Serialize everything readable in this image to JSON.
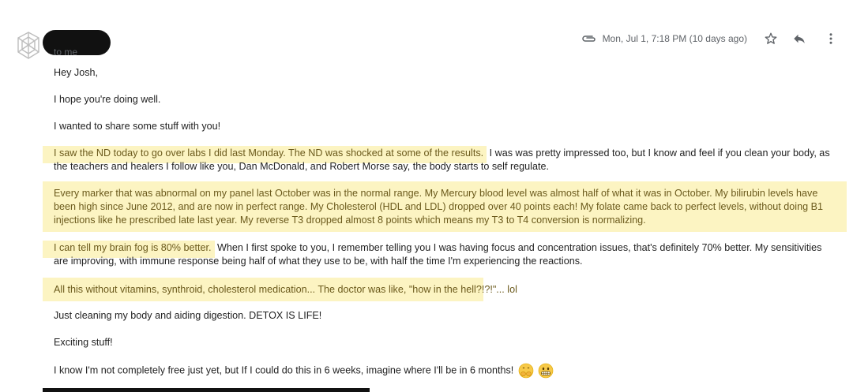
{
  "header": {
    "date": "Mon, Jul 1, 7:18 PM (10 days ago)",
    "to_line": "to me"
  },
  "icons": {
    "avatar": "default-avatar-icon",
    "attachment": "paperclip-icon",
    "star": "star-icon",
    "reply": "reply-icon",
    "more": "more-vert-icon"
  },
  "body": {
    "greeting": "Hey Josh,",
    "line1": "I hope you're doing well.",
    "line2": "I wanted to share some stuff with you!",
    "p3_highlight": "I saw the ND today to go over labs I did last Monday. The ND was shocked at some of the results.",
    "p3_rest": " I was was pretty impressed too, but I know and feel if you clean your body, as the teachers and healers I follow like you, Dan McDonald, and Robert Morse say, the body starts to self regulate.",
    "p4": "Every marker that was abnormal on my panel last October was in the normal range. My Mercury blood level was almost half of what it was in October. My bilirubin levels have been high since June 2012, and are now in perfect range. My Cholesterol (HDL and LDL) dropped over 40 points each! My folate came back to perfect levels, without doing B1 injections like he prescribed late last year. My reverse T3 dropped almost 8 points which means my T3 to T4 conversion is normalizing.",
    "p5_highlight": "I can tell my brain fog is 80% better.",
    "p5_rest": " When I first spoke to you, I remember telling you I was having focus and concentration issues, that's definitely 70% better. My sensitivities are improving, with immune response being half of what they use to be, with half the time I'm experiencing the reactions.",
    "p6": "All this without vitamins, synthroid, cholesterol medication... The doctor was like, \"how in the hell?!?!\"... lol",
    "p7": "Just cleaning my body and aiding digestion. DETOX IS LIFE!",
    "p8": "Exciting stuff!",
    "p9": "I know I'm not completely free just yet, but If I could do this in 6 weeks, imagine where I'll be in 6 months!",
    "emojis": [
      "hands-over-mouth-emoji",
      "grimacing-face-emoji"
    ]
  },
  "colors": {
    "highlight_bg": "#fcf4c2",
    "highlight_text": "#6b5a1c"
  }
}
